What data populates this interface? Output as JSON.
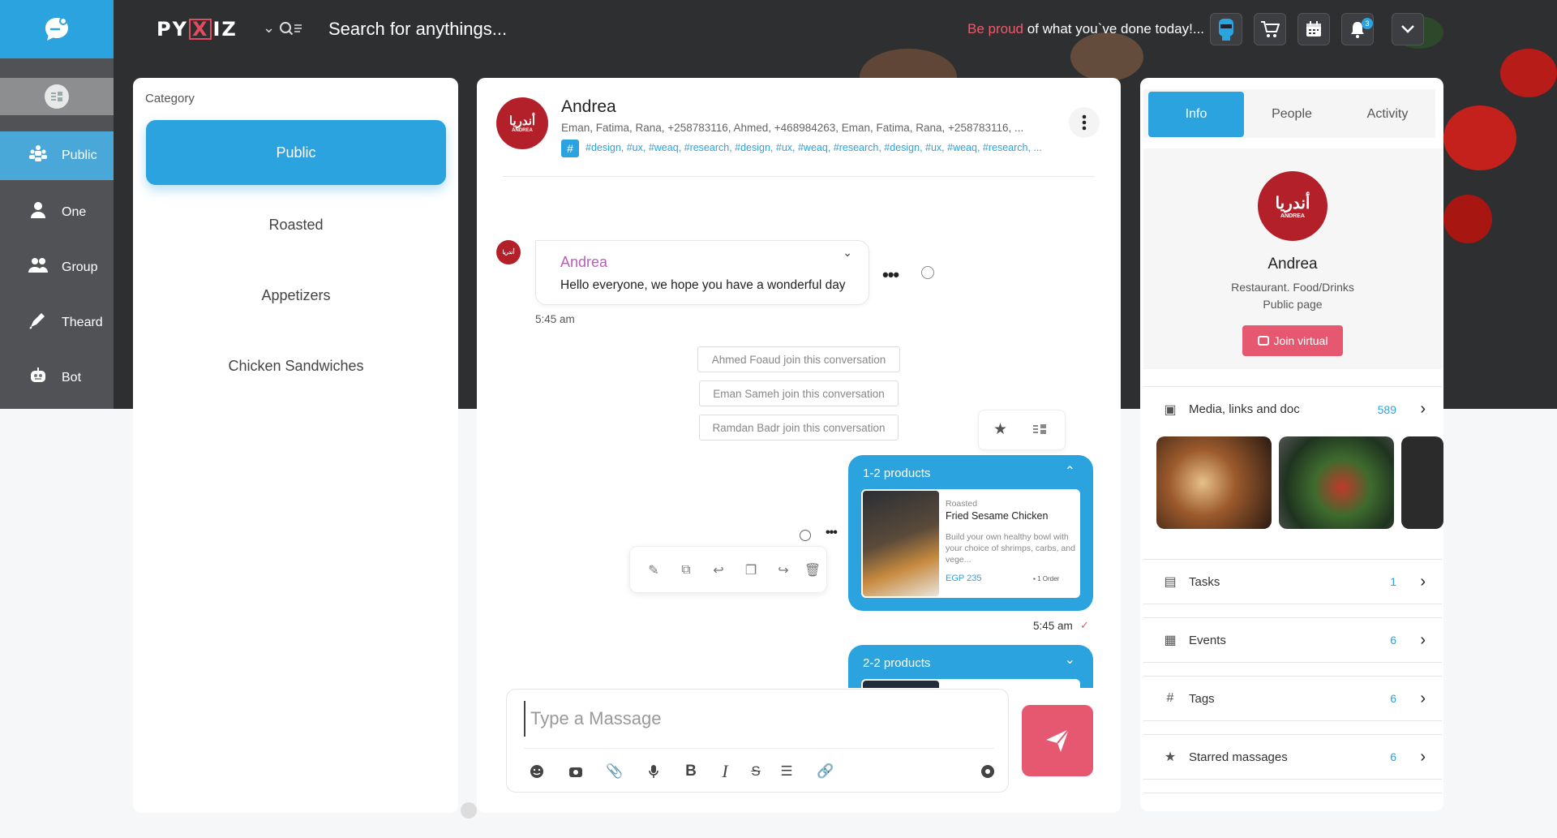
{
  "app": {
    "brand_prefix": "PY",
    "brand_x": "X",
    "brand_suffix": "IZ"
  },
  "header": {
    "search_placeholder": "Search for anythings...",
    "slogan_highlight": "Be proud",
    "slogan_rest": " of what you`ve done today!...",
    "notification_count": "3"
  },
  "sidebar": {
    "items": [
      {
        "label": "Public",
        "icon": "people-group-icon"
      },
      {
        "label": "One",
        "icon": "user-icon"
      },
      {
        "label": "Group",
        "icon": "users-icon"
      },
      {
        "label": "Theard",
        "icon": "pen-icon"
      },
      {
        "label": "Bot",
        "icon": "robot-icon"
      }
    ]
  },
  "category": {
    "label": "Category",
    "items": [
      "Public",
      "Roasted",
      "Appetizers",
      "Chicken Sandwiches"
    ]
  },
  "chat": {
    "name": "Andrea",
    "members": "Eman, Fatima, Rana, +258783116, Ahmed, +468984263, Eman, Fatima, Rana, +258783116, ...",
    "hash_symbol": "#",
    "tags": "#design, #ux, #weaq, #research, #design, #ux, #weaq, #research, #design, #ux, #weaq, #research,  ...",
    "avatar_text": "أندريا",
    "avatar_sub": "ANDREA",
    "message": {
      "sender": "Andrea",
      "text": "Hello everyone, we hope you have a wonderful day",
      "time": "5:45 am"
    },
    "system_messages": [
      "Ahmed Foaud join this conversation",
      "Eman Sameh join this conversation",
      "Ramdan Badr join this conversation"
    ],
    "product_card_1": {
      "title": "1-2 products",
      "category": "Roasted",
      "name": "Fried Sesame Chicken",
      "description": "Build your own healthy bowl with your choice of shrimps, carbs, and vege...",
      "price": "EGP 235",
      "orders": "1 Order",
      "time": "5:45 am"
    },
    "product_card_2": {
      "title": "2-2 products"
    },
    "composer_placeholder": "Type a Massage"
  },
  "info_panel": {
    "tabs": [
      "Info",
      "People",
      "Activity"
    ],
    "name": "Andrea",
    "subtitle": "Restaurant. Food/Drinks",
    "page_type": "Public page",
    "join_label": "Join virtual",
    "rows": [
      {
        "label": "Media, links and doc",
        "count": "589",
        "icon": "image-icon"
      },
      {
        "label": "Tasks",
        "count": "1",
        "icon": "tasks-icon"
      },
      {
        "label": "Events",
        "count": "6",
        "icon": "calendar-icon"
      },
      {
        "label": "Tags",
        "count": "6",
        "icon": "hash-icon"
      },
      {
        "label": "Starred massages",
        "count": "6",
        "icon": "star-icon"
      }
    ]
  },
  "colors": {
    "accent": "#2ba3de",
    "danger": "#e65870",
    "brand_red": "#b3202a"
  }
}
